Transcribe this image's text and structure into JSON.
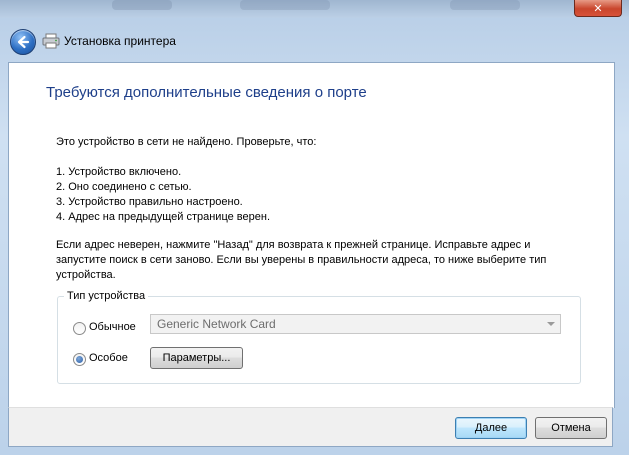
{
  "window": {
    "title": "Установка принтера",
    "close_glyph": "✕"
  },
  "icons": {
    "back": "back-arrow-icon",
    "printer": "printer-icon",
    "close": "close-icon"
  },
  "content": {
    "heading": "Требуются дополнительные сведения о порте",
    "intro": "Это устройство в сети не найдено. Проверьте, что:",
    "checklist": [
      "1.  Устройство включено.",
      "2.  Оно соединено с сетью.",
      "3.  Устройство правильно настроено.",
      "4.  Адрес на предыдущей странице верен."
    ],
    "instructions": "Если адрес неверен, нажмите \"Назад\" для возврата к прежней странице.  Исправьте адрес и запустите поиск в сети заново.  Если вы уверены в правильности адреса, то ниже выберите тип устройства."
  },
  "device_type": {
    "legend": "Тип устройства",
    "standard_label": "Обычное",
    "standard_selected": false,
    "custom_label": "Особое",
    "custom_selected": true,
    "standard_value": "Generic Network Card",
    "params_button": "Параметры..."
  },
  "footer": {
    "next_label": "Далее",
    "cancel_label": "Отмена"
  },
  "colors": {
    "heading": "#1e3f8a",
    "accent": "#3c7fb1"
  }
}
